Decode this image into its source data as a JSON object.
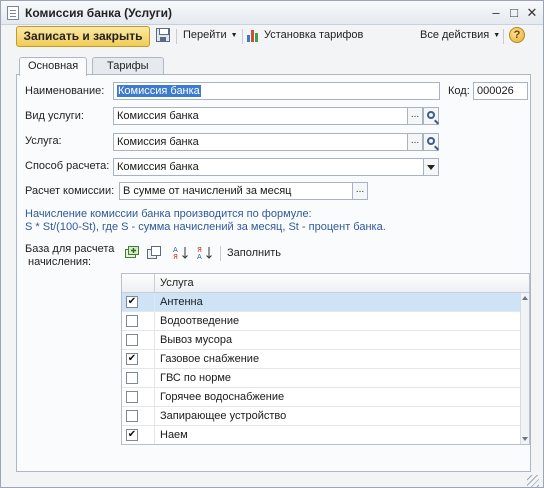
{
  "window": {
    "title": "Комиссия банка (Услуги)",
    "minimize": "–",
    "maximize": "□",
    "close": "✕"
  },
  "toolbar": {
    "save_close": "Записать и закрыть",
    "goto": "Перейти",
    "tariffs": "Установка тарифов",
    "all_actions": "Все действия",
    "help": "?"
  },
  "tabs": [
    {
      "label": "Основная",
      "active": true
    },
    {
      "label": "Тарифы",
      "active": false
    }
  ],
  "form": {
    "name_label": "Наименование:",
    "name_value": "Комиссия банка",
    "code_label": "Код:",
    "code_value": "000026",
    "service_type_label": "Вид услуги:",
    "service_type_value": "Комиссия банка",
    "service_label": "Услуга:",
    "service_value": "Комиссия банка",
    "calc_method_label": "Способ расчета:",
    "calc_method_value": "Комиссия банка",
    "commission_label": "Расчет комиссии:",
    "commission_value": "В сумме от начислений за месяц",
    "ellipsis": "..."
  },
  "note": {
    "line1": "Начисление комиссии банка производится по формуле:",
    "line2": "S * St/(100-St), где S - сумма начислений за месяц, St - процент банка."
  },
  "base": {
    "label_line1": "База для расчета",
    "label_line2": "начисления:",
    "fill_button": "Заполнить"
  },
  "table": {
    "column": "Услуга",
    "rows": [
      {
        "name": "Антенна",
        "checked": true,
        "selected": true
      },
      {
        "name": "Водоотведение",
        "checked": false,
        "selected": false
      },
      {
        "name": "Вывоз мусора",
        "checked": false,
        "selected": false
      },
      {
        "name": "Газовое снабжение",
        "checked": true,
        "selected": false
      },
      {
        "name": "ГВС по норме",
        "checked": false,
        "selected": false
      },
      {
        "name": "Горячее водоснабжение",
        "checked": false,
        "selected": false
      },
      {
        "name": "Запирающее устройство",
        "checked": false,
        "selected": false
      },
      {
        "name": "Наем",
        "checked": true,
        "selected": false
      }
    ]
  },
  "colors": {
    "accent_button": "#f1cc56",
    "selection": "#3d7bd0",
    "note_text": "#2f5a9a",
    "row_selected": "#cfe3f7"
  }
}
